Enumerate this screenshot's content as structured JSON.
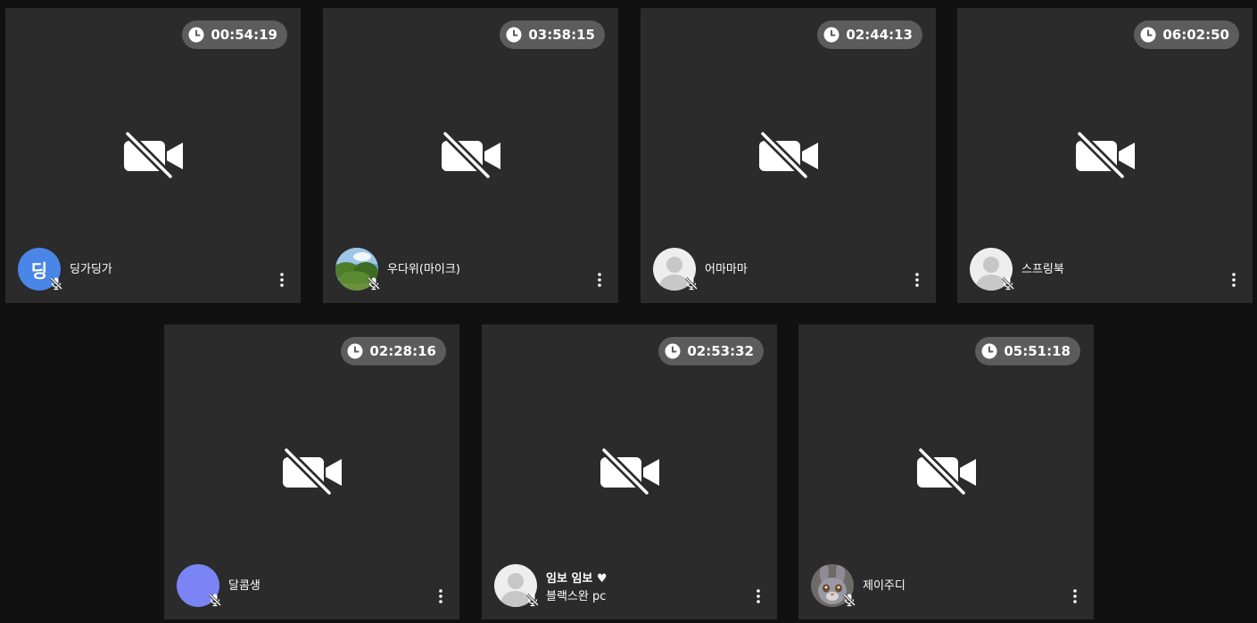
{
  "tiles": [
    {
      "name": "딩가딩가",
      "timer": "00:54:19",
      "avatar": "letter",
      "avatar_letter": "딩",
      "avatar_color": "#4a86e8"
    },
    {
      "name": "우다위(마이크)",
      "timer": "03:58:15",
      "avatar": "photo-landscape"
    },
    {
      "name": "어마마마",
      "timer": "02:44:13",
      "avatar": "default-user"
    },
    {
      "name": "스프링북",
      "timer": "06:02:50",
      "avatar": "default-user"
    },
    {
      "name": "달콤생",
      "timer": "02:28:16",
      "avatar": "solid",
      "avatar_color": "#7b84f5"
    },
    {
      "name": "임보 임보 ♥",
      "subtitle": "블랙스완 pc",
      "timer": "02:53:32",
      "avatar": "default-user"
    },
    {
      "name": "제이주디",
      "timer": "05:51:18",
      "avatar": "photo-bunny"
    }
  ],
  "icons": {
    "timer": "clock-icon",
    "camera": "video-off-icon",
    "mic": "mic-off-icon",
    "menu": "more-vertical-icon"
  },
  "colors": {
    "background": "#111111",
    "tile": "#2b2b2b",
    "timer_badge": "#5c5c5c",
    "text": "#ffffff"
  }
}
